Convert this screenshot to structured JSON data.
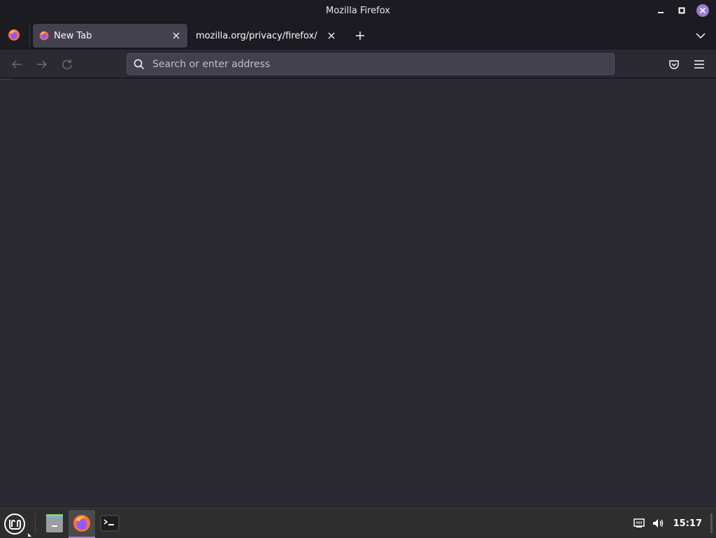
{
  "window": {
    "title": "Mozilla Firefox"
  },
  "tabs": [
    {
      "label": "New Tab",
      "active": true
    },
    {
      "label": "mozilla.org/privacy/firefox/",
      "active": false
    }
  ],
  "urlbar": {
    "placeholder": "Search or enter address",
    "value": ""
  },
  "taskbar": {
    "apps": [
      "files-icon",
      "firefox-icon",
      "terminal-icon"
    ],
    "active_app": "firefox-icon",
    "clock": "15:17"
  },
  "colors": {
    "accent": "#9a7ad6",
    "chrome_bg": "#1c1b22",
    "content_bg": "#2b2a33",
    "active_tab": "#42414d",
    "taskbar_bg": "#2e2e2e"
  }
}
